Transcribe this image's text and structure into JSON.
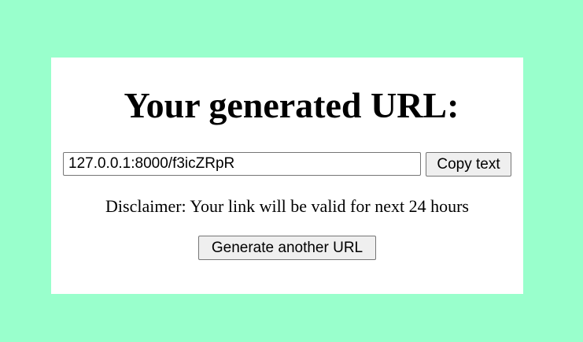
{
  "header": {
    "title": "Your generated URL:"
  },
  "url_field": {
    "value": "127.0.0.1:8000/f3icZRpR"
  },
  "actions": {
    "copy_label": "Copy text",
    "generate_label": "Generate another URL"
  },
  "disclaimer": {
    "text": "Disclaimer: Your link will be valid for next 24 hours"
  },
  "colors": {
    "page_background": "#99ffcc",
    "card_background": "#ffffff",
    "button_background": "#efefef"
  }
}
